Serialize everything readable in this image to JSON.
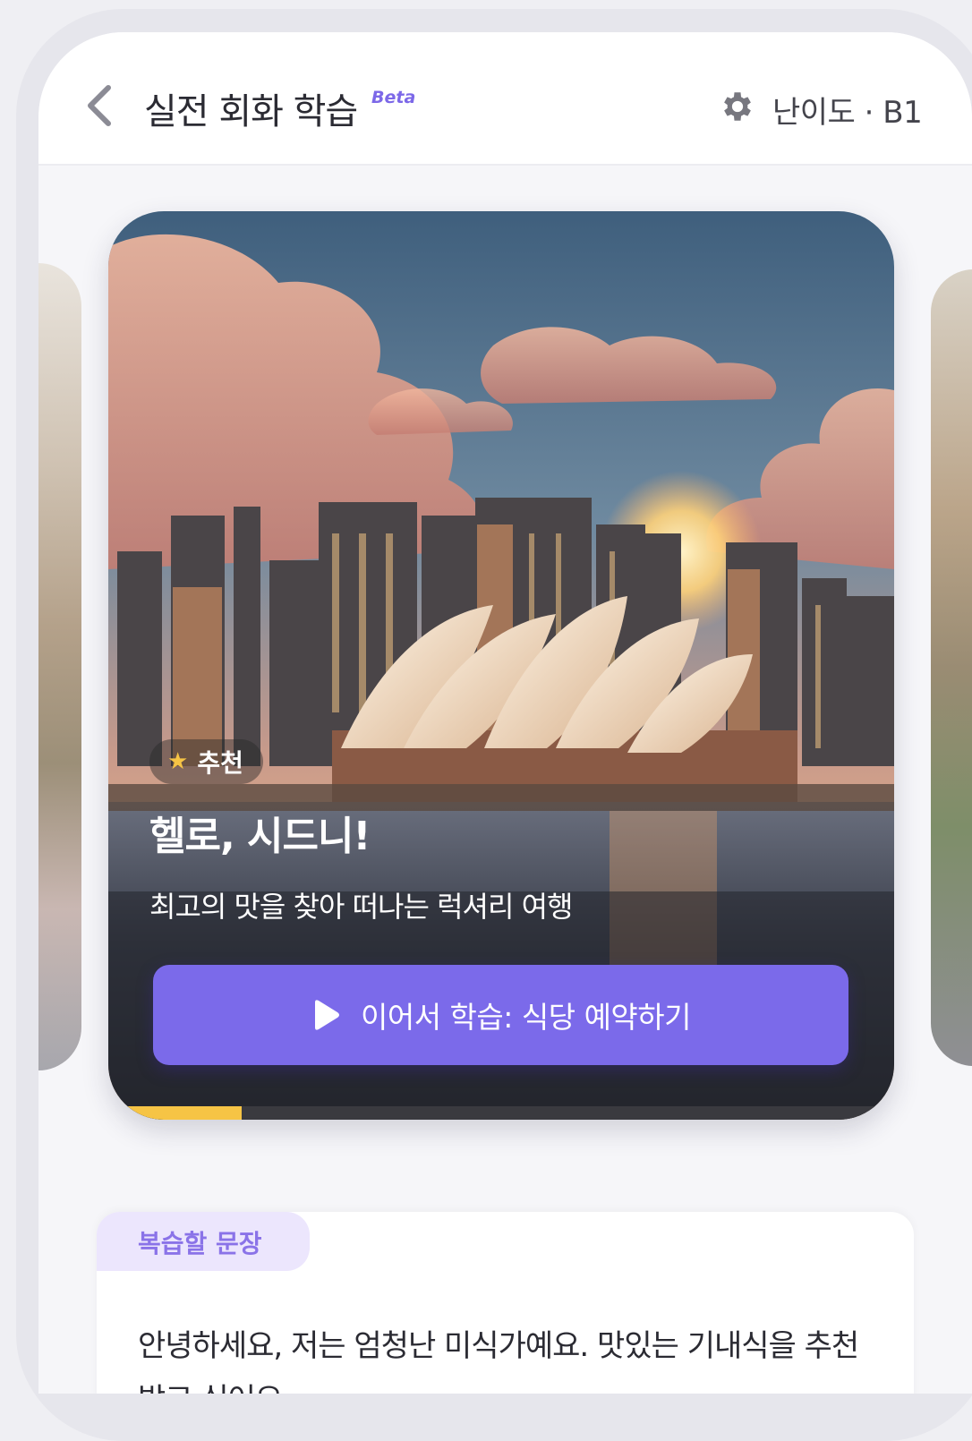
{
  "header": {
    "title": "실전 회화 학습",
    "beta_label": "Beta",
    "level_label": "난이도 · B1"
  },
  "featured_card": {
    "badge": "추천",
    "title": "헬로, 시드니!",
    "subtitle": "최고의 맛을 찾아 떠나는 럭셔리 여행",
    "cta_label": "이어서 학습: 식당 예약하기",
    "progress_percent": 17
  },
  "review": {
    "tab_label": "복습할 문장",
    "sentence": "안녕하세요, 저는 엄청난 미식가예요. 맛있는 기내식을 추천받고 싶어요."
  },
  "colors": {
    "accent": "#7b6aea",
    "progress": "#f6c445",
    "review_tab_bg": "#ece6fd"
  }
}
